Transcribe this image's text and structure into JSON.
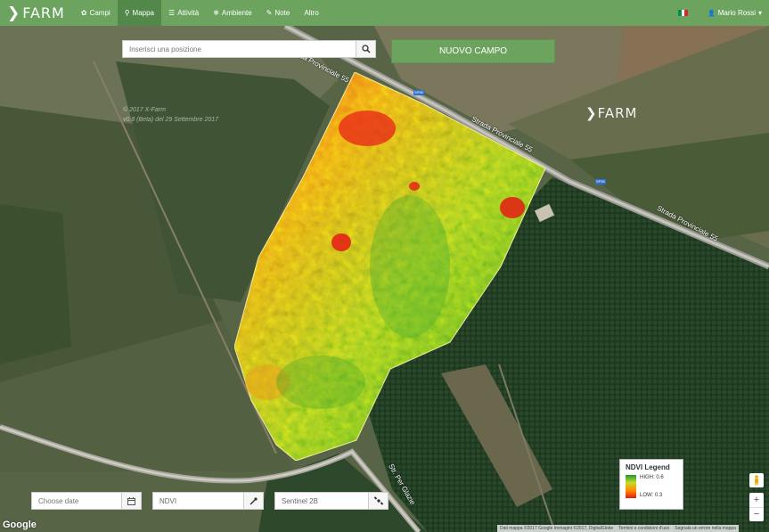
{
  "brand": {
    "chevron": "❯",
    "name": "FARM"
  },
  "nav": {
    "items": [
      {
        "icon": "✿",
        "label": "Campi",
        "icon_name": "sprout-icon"
      },
      {
        "icon": "⚲",
        "label": "Mappa",
        "icon_name": "map-marker-icon",
        "active": true
      },
      {
        "icon": "☰",
        "label": "Attività",
        "icon_name": "list-icon"
      },
      {
        "icon": "❄",
        "label": "Ambiente",
        "icon_name": "drop-icon"
      },
      {
        "icon": "✎",
        "label": "Note",
        "icon_name": "edit-icon"
      },
      {
        "icon": "",
        "label": "Altro",
        "icon_name": ""
      }
    ],
    "user": {
      "icon": "👤",
      "name": "Mario Rossi",
      "caret": "▾"
    }
  },
  "search": {
    "placeholder": "Inserisci una posizione"
  },
  "new_field_label": "NUOVO CAMPO",
  "map": {
    "copyright_line1": "© 2017 X-Farm",
    "copyright_line2": "v0.8 (Beta) del 29 Settembre 2017",
    "logo": "❯FARM",
    "roads": [
      {
        "label": "Strada Provinciale 55"
      },
      {
        "label": "Strada Provinciale 55"
      },
      {
        "label": "Strada Provinciale 55"
      },
      {
        "label": "Str. Per Glazie"
      }
    ],
    "road_badge": "SP55",
    "google": "Google",
    "attribution": [
      "Dati mappa ©2017 Google Immagini ©2017, DigitalGlobe",
      "Termini e condizioni d'uso",
      "Segnala un errore nella mappa"
    ]
  },
  "controls": {
    "date_placeholder": "Choose date",
    "index_value": "NDVI",
    "satellite_value": "Sentinel 2B"
  },
  "legend": {
    "title": "NDVI Legend",
    "high": "HIGH: 0.6",
    "low": "LOW: 0.3"
  },
  "zoom": {
    "in": "+",
    "out": "−"
  },
  "colors": {
    "brand_green": "#6ca45f",
    "brand_green_dark": "#52894b",
    "flag": [
      "#009246",
      "#ffffff",
      "#ce2b37"
    ]
  }
}
